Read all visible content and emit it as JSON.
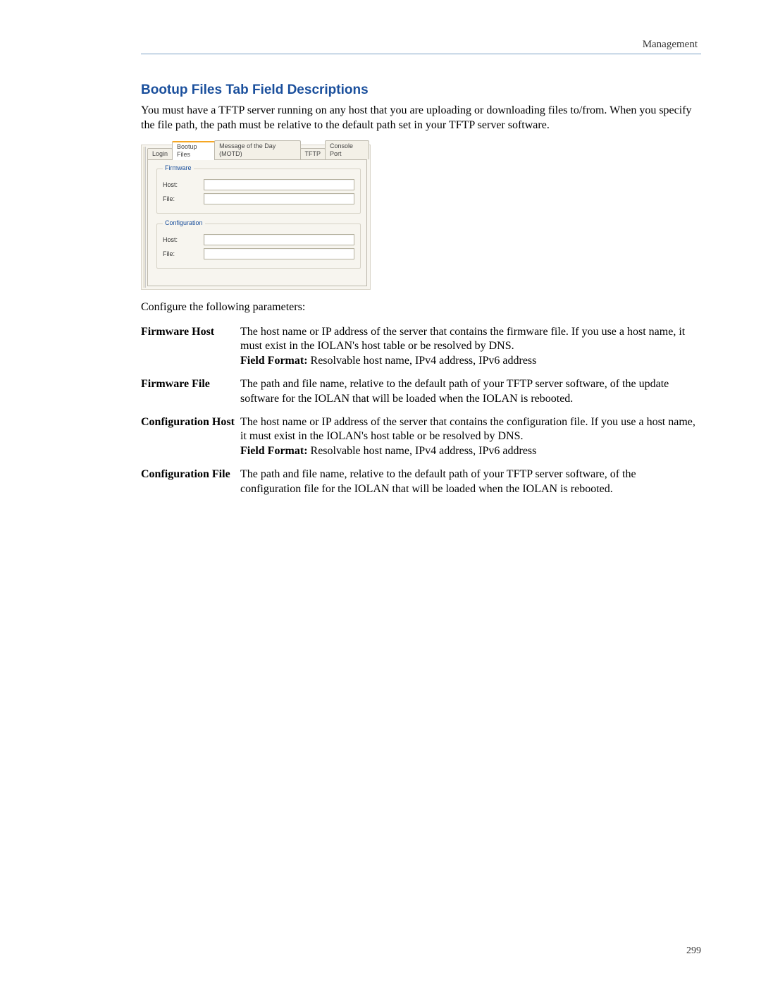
{
  "header": {
    "breadcrumb": "Management"
  },
  "section": {
    "title": "Bootup Files Tab Field Descriptions",
    "intro": "You must have a TFTP server running on any host that you are uploading or downloading files to/from. When you specify the file path, the path must be relative to the default path set in your TFTP server software.",
    "caption": "Configure the following parameters:"
  },
  "screenshot": {
    "tabs": {
      "login": "Login",
      "bootup": "Bootup Files",
      "motd": "Message of the Day (MOTD)",
      "tftp": "TFTP",
      "console": "Console Port"
    },
    "groups": {
      "firmware": {
        "legend": "Firmware",
        "host_label": "Host:",
        "file_label": "File:"
      },
      "configuration": {
        "legend": "Configuration",
        "host_label": "Host:",
        "file_label": "File:"
      }
    }
  },
  "defs": {
    "rows": [
      {
        "term": "Firmware Host",
        "desc": "The host name or IP address of the server that contains the firmware file. If you use a host name, it must exist in the IOLAN's host table or be resolved by DNS.",
        "field_format_label": "Field Format:",
        "field_format": "Resolvable host name, IPv4 address, IPv6 address"
      },
      {
        "term": "Firmware File",
        "desc": "The path and file name, relative to the default path of your TFTP server software, of the update software for the IOLAN that will be loaded when the IOLAN is rebooted."
      },
      {
        "term": "Configuration Host",
        "desc": "The host name or IP address of the server that contains the configuration file. If you use a host name, it must exist in the IOLAN's host table or be resolved by DNS.",
        "field_format_label": "Field Format:",
        "field_format": "Resolvable host name, IPv4 address, IPv6 address"
      },
      {
        "term": "Configuration File",
        "desc": "The path and file name, relative to the default path of your TFTP server software, of the configuration file for the IOLAN that will be loaded when the IOLAN is rebooted."
      }
    ]
  },
  "page_number": "299"
}
